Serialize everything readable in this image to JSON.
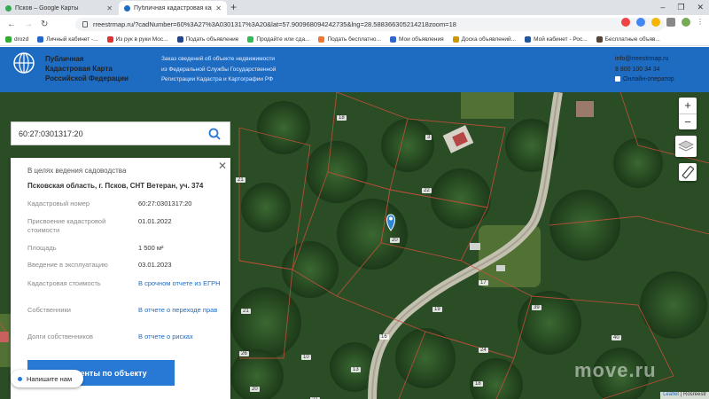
{
  "browser": {
    "tabs": [
      {
        "title": "Псков – Google Карты",
        "active": false
      },
      {
        "title": "Публичная кадастровая карта",
        "active": true
      }
    ],
    "new_tab": "+",
    "window_controls": [
      "–",
      "❐",
      "✕"
    ],
    "url": "rreestrmap.ru/?cadNumber=60%3A27%3A0301317%3A20&lat=57.900968094242735&lng=28.588366305214218zoom=18",
    "bookmarks": [
      "drozd",
      "Личный кабинет -...",
      "Из рук в руки Мос...",
      "Подать объявление",
      "Продайте или сда...",
      "Подать бесплатно...",
      "Мои объявления",
      "Доска объявлений...",
      "Мой кабинет - Рос...",
      "Бесплатные объяв..."
    ]
  },
  "header": {
    "brand_lines": [
      "Публичная",
      "Кадастровая Карта",
      "Российской Федерации"
    ],
    "order_lines": [
      "Заказ сведений об объекте недвижимости",
      "из Федеральной Службы Государственной",
      "Регистрации Кадастра и Картографии РФ"
    ],
    "email": "info@rreestrmap.ru",
    "phone": "8 800 100 34 34",
    "online": "Онлайн-оператор"
  },
  "search": {
    "value": "60:27:0301317:20"
  },
  "card": {
    "kind": "В целях ведения садоводства",
    "address": "Псковская область, г. Псков, СНТ Ветеран, уч. 374",
    "rows": [
      {
        "key": "Кадастровый номер",
        "value": "60:27:0301317:20"
      },
      {
        "key": "Присвоение кадастровой стоимости",
        "value": "01.01.2022"
      },
      {
        "key": "Площадь",
        "value": "1 500 м²"
      },
      {
        "key": "Введение в эксплуатацию",
        "value": "03.01.2023"
      },
      {
        "key": "Кадастровая стоимость",
        "value": "В срочном отчете из ЕГРН"
      },
      {
        "key": "Собственники",
        "value": "В отчете о переходе прав"
      },
      {
        "key": "Долги собственников",
        "value": "В отчете о рисках"
      }
    ],
    "docs_button": "Документы по объекту"
  },
  "chat": "Напишите нам",
  "map": {
    "zoom_in": "+",
    "zoom_out": "−",
    "plot_labels": [
      "18",
      "3",
      "21",
      "22",
      "20",
      "17",
      "19",
      "21",
      "26",
      "16",
      "24",
      "20",
      "39",
      "40",
      "10",
      "13",
      "18",
      "21"
    ],
    "attribution_link": "Leaflet",
    "attribution_text": "| Rosreestr",
    "watermark": "move.ru"
  }
}
